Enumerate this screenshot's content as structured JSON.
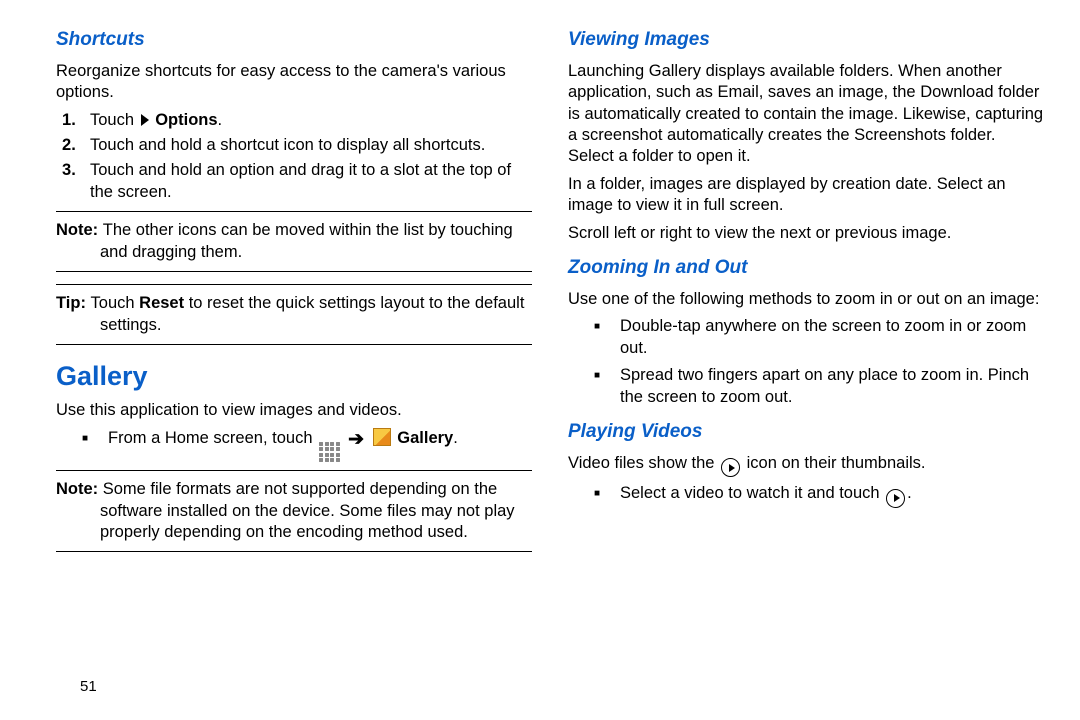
{
  "page_number": "51",
  "left": {
    "shortcuts": {
      "title": "Shortcuts",
      "intro": "Reorganize shortcuts for easy access to the camera's various options.",
      "steps": [
        {
          "pre": "Touch ",
          "boldAfter": "Options",
          "tail": "."
        },
        {
          "text": "Touch and hold a shortcut icon to display all shortcuts."
        },
        {
          "text": "Touch and hold an option and drag it to a slot at the top of the screen."
        }
      ],
      "note": {
        "label": "Note: ",
        "text": "The other icons can be moved within the list by touching and dragging them."
      },
      "tip": {
        "label": "Tip: ",
        "pre": "Touch ",
        "bold": "Reset",
        "post": " to reset the quick settings layout to the default settings."
      }
    },
    "gallery": {
      "title": "Gallery",
      "intro": "Use this application to view images and videos.",
      "launch": {
        "pre": "From a Home screen, touch ",
        "bold": "Gallery",
        "tail": "."
      },
      "note": {
        "label": "Note: ",
        "text": "Some file formats are not supported depending on the software installed on the device. Some files may not play properly depending on the encoding method used."
      }
    }
  },
  "right": {
    "viewing": {
      "title": "Viewing Images",
      "p1": "Launching Gallery displays available folders. When another application, such as Email, saves an image, the Download folder is automatically created to contain the image. Likewise, capturing a screenshot automatically creates the Screenshots folder. Select a folder to open it.",
      "p2": "In a folder, images are displayed by creation date. Select an image to view it in full screen.",
      "p3": "Scroll left or right to view the next or previous image."
    },
    "zoom": {
      "title": "Zooming In and Out",
      "intro": "Use one of the following methods to zoom in or out on an image:",
      "items": [
        "Double-tap anywhere on the screen to zoom in or zoom out.",
        "Spread two fingers apart on any place to zoom in. Pinch the screen to zoom out."
      ]
    },
    "videos": {
      "title": "Playing Videos",
      "intro_pre": "Video files show the ",
      "intro_post": " icon on their thumbnails.",
      "item_pre": "Select a video to watch it and touch ",
      "item_post": "."
    }
  }
}
